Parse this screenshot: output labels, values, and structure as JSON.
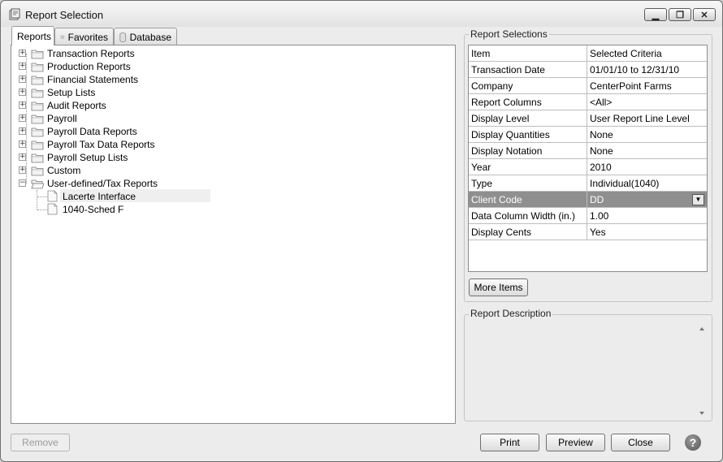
{
  "window": {
    "title": "Report Selection"
  },
  "tabs": [
    {
      "label": "Reports",
      "icon": "none"
    },
    {
      "label": "Favorites",
      "icon": "star-icon"
    },
    {
      "label": "Database",
      "icon": "database-icon"
    }
  ],
  "tree": {
    "folders": [
      "Transaction Reports",
      "Production Reports",
      "Financial Statements",
      "Setup Lists",
      "Audit Reports",
      "Payroll",
      "Payroll Data Reports",
      "Payroll Tax Data Reports",
      "Payroll Setup Lists",
      "Custom",
      "User-defined/Tax Reports"
    ],
    "children": [
      "Lacerte Interface",
      "1040-Sched F"
    ]
  },
  "report_selections": {
    "title": "Report Selections",
    "columns": [
      "Item",
      "Selected Criteria"
    ],
    "rows": [
      [
        "Transaction Date",
        "01/01/10 to 12/31/10"
      ],
      [
        "Company",
        "CenterPoint Farms"
      ],
      [
        "Report Columns",
        "<All>"
      ],
      [
        "Display Level",
        "User Report Line Level"
      ],
      [
        "Display Quantities",
        "None"
      ],
      [
        "Display Notation",
        "None"
      ],
      [
        "Year",
        "2010"
      ],
      [
        "Type",
        "Individual(1040)"
      ],
      [
        "Client Code",
        "DD"
      ],
      [
        "Data Column Width (in.)",
        "1.00"
      ],
      [
        "Display Cents",
        "Yes"
      ]
    ],
    "more_items_label": "More Items"
  },
  "report_description": {
    "title": "Report Description"
  },
  "buttons": {
    "remove": "Remove",
    "print": "Print",
    "preview": "Preview",
    "close": "Close",
    "help": "?"
  },
  "colors": {
    "highlight_row": "#8f8f8f",
    "window_bg": "#ececec"
  }
}
